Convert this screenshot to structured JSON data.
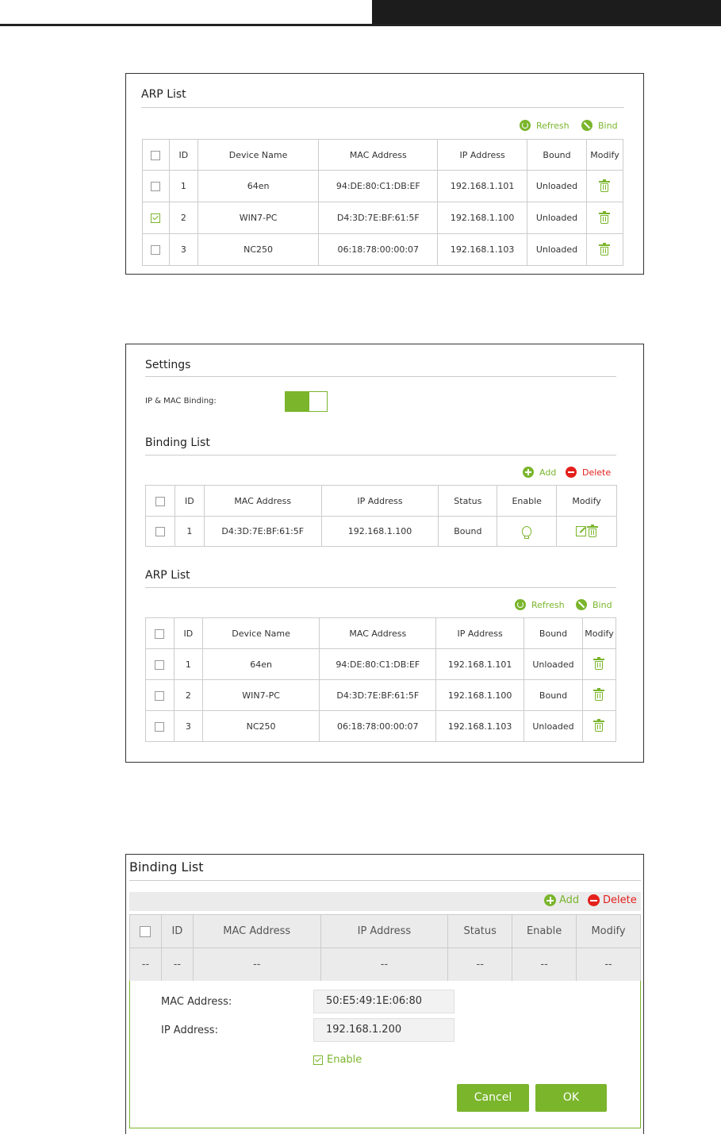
{
  "panel1": {
    "title": "ARP List",
    "actions": {
      "refresh": "Refresh",
      "bind": "Bind"
    },
    "columns": [
      "ID",
      "Device Name",
      "MAC Address",
      "IP Address",
      "Bound",
      "Modify"
    ],
    "rows": [
      {
        "checked": false,
        "id": "1",
        "device": "64en",
        "mac": "94:DE:80:C1:DB:EF",
        "ip": "192.168.1.101",
        "bound": "Unloaded"
      },
      {
        "checked": true,
        "id": "2",
        "device": "WIN7-PC",
        "mac": "D4:3D:7E:BF:61:5F",
        "ip": "192.168.1.100",
        "bound": "Unloaded"
      },
      {
        "checked": false,
        "id": "3",
        "device": "NC250",
        "mac": "06:18:78:00:00:07",
        "ip": "192.168.1.103",
        "bound": "Unloaded"
      }
    ]
  },
  "panel2": {
    "settings_title": "Settings",
    "ipmac_label": "IP & MAC Binding:",
    "binding_title": "Binding List",
    "binding_actions": {
      "add": "Add",
      "delete": "Delete"
    },
    "binding_columns": [
      "ID",
      "MAC Address",
      "IP Address",
      "Status",
      "Enable",
      "Modify"
    ],
    "binding_rows": [
      {
        "id": "1",
        "mac": "D4:3D:7E:BF:61:5F",
        "ip": "192.168.1.100",
        "status": "Bound"
      }
    ],
    "arp_title": "ARP List",
    "arp_actions": {
      "refresh": "Refresh",
      "bind": "Bind"
    },
    "arp_columns": [
      "ID",
      "Device Name",
      "MAC Address",
      "IP Address",
      "Bound",
      "Modify"
    ],
    "arp_rows": [
      {
        "id": "1",
        "device": "64en",
        "mac": "94:DE:80:C1:DB:EF",
        "ip": "192.168.1.101",
        "bound": "Unloaded"
      },
      {
        "id": "2",
        "device": "WIN7-PC",
        "mac": "D4:3D:7E:BF:61:5F",
        "ip": "192.168.1.100",
        "bound": "Bound"
      },
      {
        "id": "3",
        "device": "NC250",
        "mac": "06:18:78:00:00:07",
        "ip": "192.168.1.103",
        "bound": "Unloaded"
      }
    ]
  },
  "panel3": {
    "title": "Binding List",
    "actions": {
      "add": "Add",
      "delete": "Delete"
    },
    "columns": [
      "ID",
      "MAC Address",
      "IP Address",
      "Status",
      "Enable",
      "Modify"
    ],
    "empty_cell": "--",
    "form": {
      "mac_label": "MAC Address:",
      "mac_value": "50:E5:49:1E:06:80",
      "ip_label": "IP Address:",
      "ip_value": "192.168.1.200",
      "enable_label": "Enable",
      "cancel": "Cancel",
      "ok": "OK"
    }
  },
  "colors": {
    "accent": "#7ab52c",
    "danger": "#e3201c"
  }
}
